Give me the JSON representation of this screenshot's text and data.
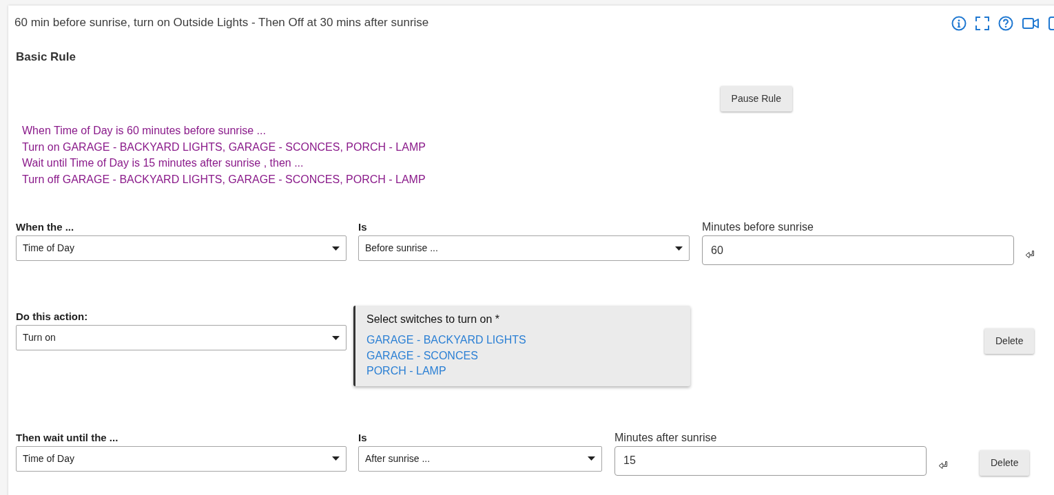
{
  "header": {
    "title": "60 min before sunrise, turn on Outside Lights - Then Off at 30 mins after sunrise"
  },
  "section": {
    "title": "Basic Rule",
    "pause_button": "Pause Rule"
  },
  "summary": [
    "When Time of Day is 60 minutes before sunrise ...",
    "Turn on GARAGE - BACKYARD LIGHTS, GARAGE - SCONCES, PORCH - LAMP",
    "Wait until Time of Day is 15 minutes after sunrise , then ...",
    "Turn off GARAGE - BACKYARD LIGHTS, GARAGE - SCONCES, PORCH - LAMP"
  ],
  "rows": [
    {
      "kind": "condition",
      "subject_label": "When the ...",
      "subject": "Time of Day",
      "comparison_label": "Is",
      "comparison": "Before sunrise ...",
      "minutes_label": "Minutes before sunrise",
      "minutes": "60"
    },
    {
      "kind": "action",
      "subject_label": "Do this action:",
      "subject": "Turn on",
      "picker": {
        "label": "Select switches to turn on *",
        "items": [
          "GARAGE - BACKYARD LIGHTS",
          "GARAGE - SCONCES",
          "PORCH - LAMP"
        ]
      },
      "delete_button": "Delete"
    },
    {
      "kind": "wait",
      "subject_label": "Then wait until the ...",
      "subject": "Time of Day",
      "comparison_label": "Is",
      "comparison": "After sunrise ...",
      "minutes_label": "Minutes after sunrise",
      "minutes": "15",
      "delete_button": "Delete"
    }
  ]
}
